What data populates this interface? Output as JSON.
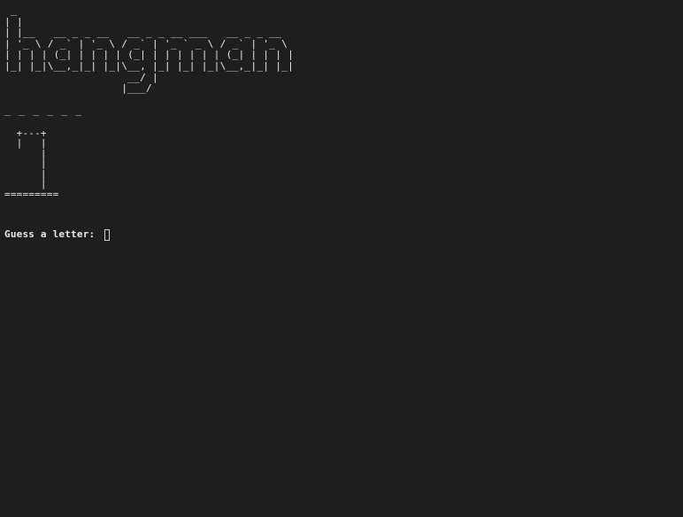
{
  "terminal": {
    "background": "#1e1e1e",
    "foreground": "#e8e8e8",
    "banner": " _\n| |\n| |__   __ _ _ __   __ _ _ __ ___   __ _ _ __\n| '_ \\ / _` | '_ \\ / _` | '_ ` _ \\ / _` | '_ \\\n| | | | (_| | | | | (_| | | | | | | (_| | | | |\n|_| |_|\\__,_|_| |_|\\__, |_| |_| |_|\\__,_|_| |_|\n                    __/ |\n                   |___/",
    "word_blanks": "_ _ _ _ _ _",
    "gallows": "  +---+\n  |   |\n      |\n      |\n      |\n      |\n=========",
    "prompt": "Guess a letter: ",
    "input_value": ""
  }
}
